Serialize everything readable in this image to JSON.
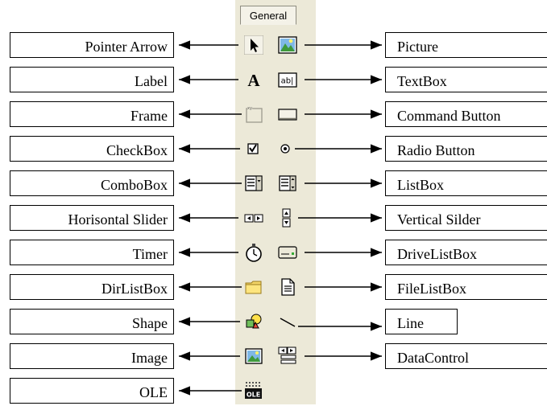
{
  "toolbox": {
    "tab_label": "General"
  },
  "rows": [
    {
      "left": "Pointer Arrow",
      "right": "Picture",
      "left_icon": "pointer-arrow-icon",
      "right_icon": "picture-icon"
    },
    {
      "left": "Label",
      "right": "TextBox",
      "left_icon": "label-icon",
      "right_icon": "textbox-icon"
    },
    {
      "left": "Frame",
      "right": "Command Button",
      "left_icon": "frame-icon",
      "right_icon": "command-button-icon"
    },
    {
      "left": "CheckBox",
      "right": "Radio Button",
      "left_icon": "checkbox-icon",
      "right_icon": "radio-button-icon"
    },
    {
      "left": "ComboBox",
      "right": "ListBox",
      "left_icon": "combobox-icon",
      "right_icon": "listbox-icon"
    },
    {
      "left": "Horisontal Slider",
      "right": "Vertical Silder",
      "left_icon": "horizontal-slider-icon",
      "right_icon": "vertical-slider-icon"
    },
    {
      "left": "Timer",
      "right": "DriveListBox",
      "left_icon": "timer-icon",
      "right_icon": "drive-listbox-icon"
    },
    {
      "left": "DirListBox",
      "right": "FileListBox",
      "left_icon": "dir-listbox-icon",
      "right_icon": "file-listbox-icon"
    },
    {
      "left": "Shape",
      "right": "Line",
      "left_icon": "shape-icon",
      "right_icon": "line-icon"
    },
    {
      "left": "Image",
      "right": "DataControl",
      "left_icon": "image-icon",
      "right_icon": "data-control-icon"
    },
    {
      "left": "OLE",
      "right": null,
      "left_icon": "ole-icon",
      "right_icon": null
    }
  ],
  "label_A": "A",
  "textbox_glyph": "ab|",
  "ole_glyph": "OLE"
}
